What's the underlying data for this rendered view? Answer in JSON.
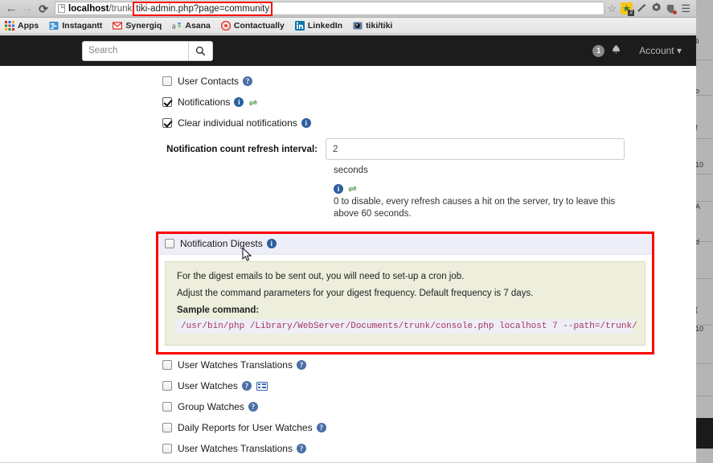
{
  "browser": {
    "nav": {
      "back": "←",
      "forward": "→",
      "reload": "⟳"
    },
    "url_base_bold": "localhost",
    "url_base_path": "/trunk",
    "url_highlight": "tiki-admin.php?page=community",
    "toolbar_icons": [
      "star-icon",
      "extension-badge-icon",
      "wand-icon",
      "gear-icon",
      "evernote-icon",
      "menu-icon"
    ],
    "extension_badge_count": "2",
    "bookmarks": [
      {
        "label": "Apps",
        "icon": "apps-grid-icon"
      },
      {
        "label": "Instagantt",
        "icon": "instagantt-icon"
      },
      {
        "label": "Synergiq",
        "icon": "gmail-icon"
      },
      {
        "label": "Asana",
        "icon": "asana-icon"
      },
      {
        "label": "Contactually",
        "icon": "contactually-icon"
      },
      {
        "label": "LinkedIn",
        "icon": "linkedin-icon"
      },
      {
        "label": "tiki/tiki",
        "icon": "tiki-icon"
      }
    ]
  },
  "topbar": {
    "search_placeholder": "Search",
    "search_value": "",
    "search_button_icon": "search-icon",
    "notification_count": "1",
    "bell_icon": "bell-icon",
    "account_label": "Account",
    "account_caret": "▾"
  },
  "settings": {
    "user_contacts": {
      "label": "User Contacts",
      "checked": false,
      "help": "help-question-icon"
    },
    "notifications": {
      "label": "Notifications",
      "checked": true,
      "help": "help-info-icon",
      "undo": "undo-arrow-icon"
    },
    "clear_individual": {
      "label": "Clear individual notifications",
      "checked": true,
      "help": "help-info-icon"
    },
    "interval": {
      "label": "Notification count refresh interval:",
      "value": "2",
      "units": "seconds",
      "help": "help-info-icon",
      "undo": "undo-arrow-icon",
      "hint": "0 to disable, every refresh causes a hit on the server, try to leave this above 60 seconds."
    },
    "digest": {
      "label": "Notification Digests",
      "checked": false,
      "help": "help-info-icon",
      "line1": "For the digest emails to be sent out, you will need to set-up a cron job.",
      "line2": "Adjust the command parameters for your digest frequency. Default frequency is 7 days.",
      "sample_title": "Sample command:",
      "command": "/usr/bin/php /Library/WebServer/Documents/trunk/console.php localhost 7 --path=/trunk/",
      "highlight_color": "#ff0000",
      "header_bg": "#eeeef8",
      "body_bg": "#eeeedd",
      "code_color": "#a3355f"
    },
    "watch_items": [
      {
        "label": "User Watches Translations",
        "checked": false,
        "help": "help-question-icon",
        "extra": null
      },
      {
        "label": "User Watches",
        "checked": false,
        "help": "help-question-icon",
        "extra": "list-icon"
      },
      {
        "label": "Group Watches",
        "checked": false,
        "help": "help-question-icon",
        "extra": null
      },
      {
        "label": "Daily Reports for User Watches",
        "checked": false,
        "help": "help-question-icon",
        "extra": null
      },
      {
        "label": "User Watches Translations",
        "checked": false,
        "help": "help-question-icon",
        "extra": null
      }
    ]
  }
}
